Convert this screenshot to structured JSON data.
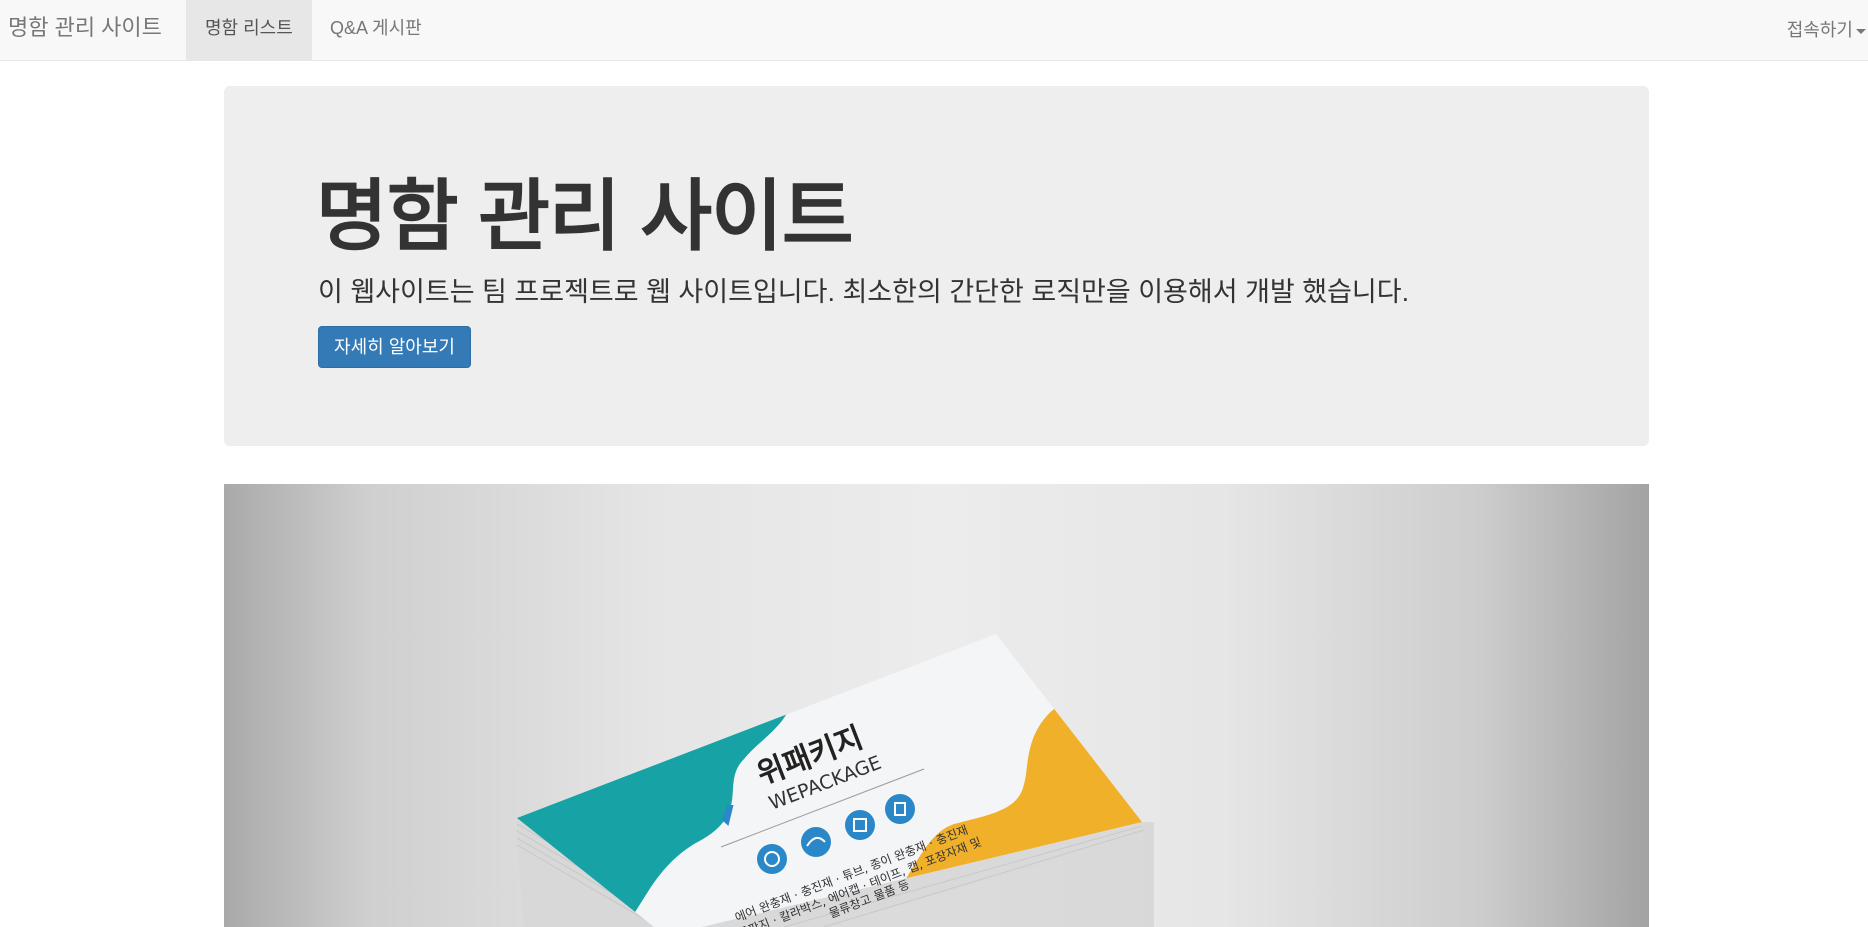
{
  "navbar": {
    "brand": "명함 관리 사이트",
    "items": [
      {
        "label": "명함 리스트",
        "active": true
      },
      {
        "label": "Q&A 게시판",
        "active": false
      }
    ],
    "login_label": "접속하기"
  },
  "jumbotron": {
    "title": "명함 관리 사이트",
    "lead": "이 웹사이트는 팀 프로젝트로 웹 사이트입니다. 최소한의 간단한 로직만을 이용해서 개발 했습니다.",
    "button_label": "자세히 알아보기"
  },
  "hero_card": {
    "brand_ko": "위패키지",
    "brand_en": "WEPACKAGE",
    "lines": [
      "에어 완충재 · 충진재 · 튜브, 종이 완충재 · 충진재",
      "골판지 · 칼라박스, 에어캡 · 테이프, 캡, 포장자재 및",
      "물류창고 물품 등"
    ]
  },
  "colors": {
    "primary": "#337ab7",
    "teal": "#17a2a6",
    "yellow": "#f0b02a",
    "icon_blue": "#2b88c8"
  }
}
